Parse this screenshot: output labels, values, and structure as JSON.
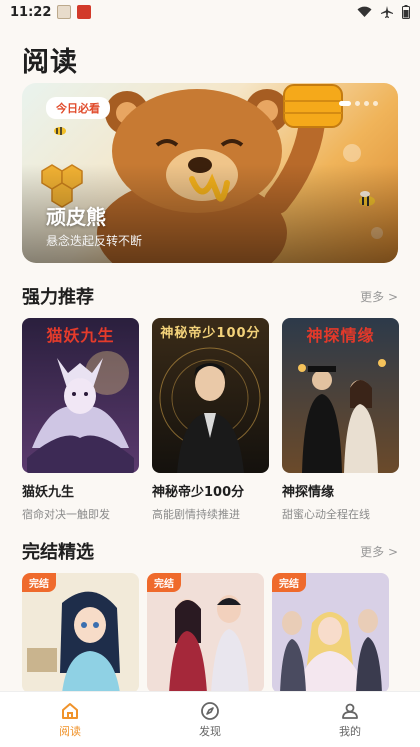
{
  "status_bar": {
    "time": "11:22",
    "icons": [
      "app-thumbnail-icon",
      "app-badge-icon",
      "wifi-icon",
      "airplane-icon",
      "battery-icon"
    ]
  },
  "page": {
    "title": "阅读"
  },
  "banner": {
    "tag": "今日必看",
    "title": "顽皮熊",
    "subtitle": "悬念迭起反转不断",
    "slide_count": 4,
    "active_slide": 0
  },
  "recommend": {
    "title": "强力推荐",
    "more": "更多 >",
    "items": [
      {
        "title": "猫妖九生",
        "desc": "宿命对决一触即发",
        "cover_text": "猫妖九生",
        "cover_text_color": "#e43b2b"
      },
      {
        "title": "神秘帝少100分",
        "desc": "高能剧情持续推进",
        "cover_text": "神秘帝少100分",
        "cover_text_color": "#f3d27a"
      },
      {
        "title": "神探情缘",
        "desc": "甜蜜心动全程在线",
        "cover_text": "神探情缘",
        "cover_text_color": "#e4392a"
      }
    ]
  },
  "finished": {
    "title": "完结精选",
    "more": "更多 >",
    "items": [
      {
        "badge": "完结"
      },
      {
        "badge": "完结"
      },
      {
        "badge": "完结"
      }
    ]
  },
  "bottom_nav": {
    "items": [
      {
        "label": "阅读",
        "icon": "home-icon",
        "active": true
      },
      {
        "label": "发现",
        "icon": "compass-icon",
        "active": false
      },
      {
        "label": "我的",
        "icon": "user-icon",
        "active": false
      }
    ]
  },
  "colors": {
    "accent": "#f0932b",
    "badge": "#ef6a2c",
    "tag_text": "#e04a2a"
  }
}
